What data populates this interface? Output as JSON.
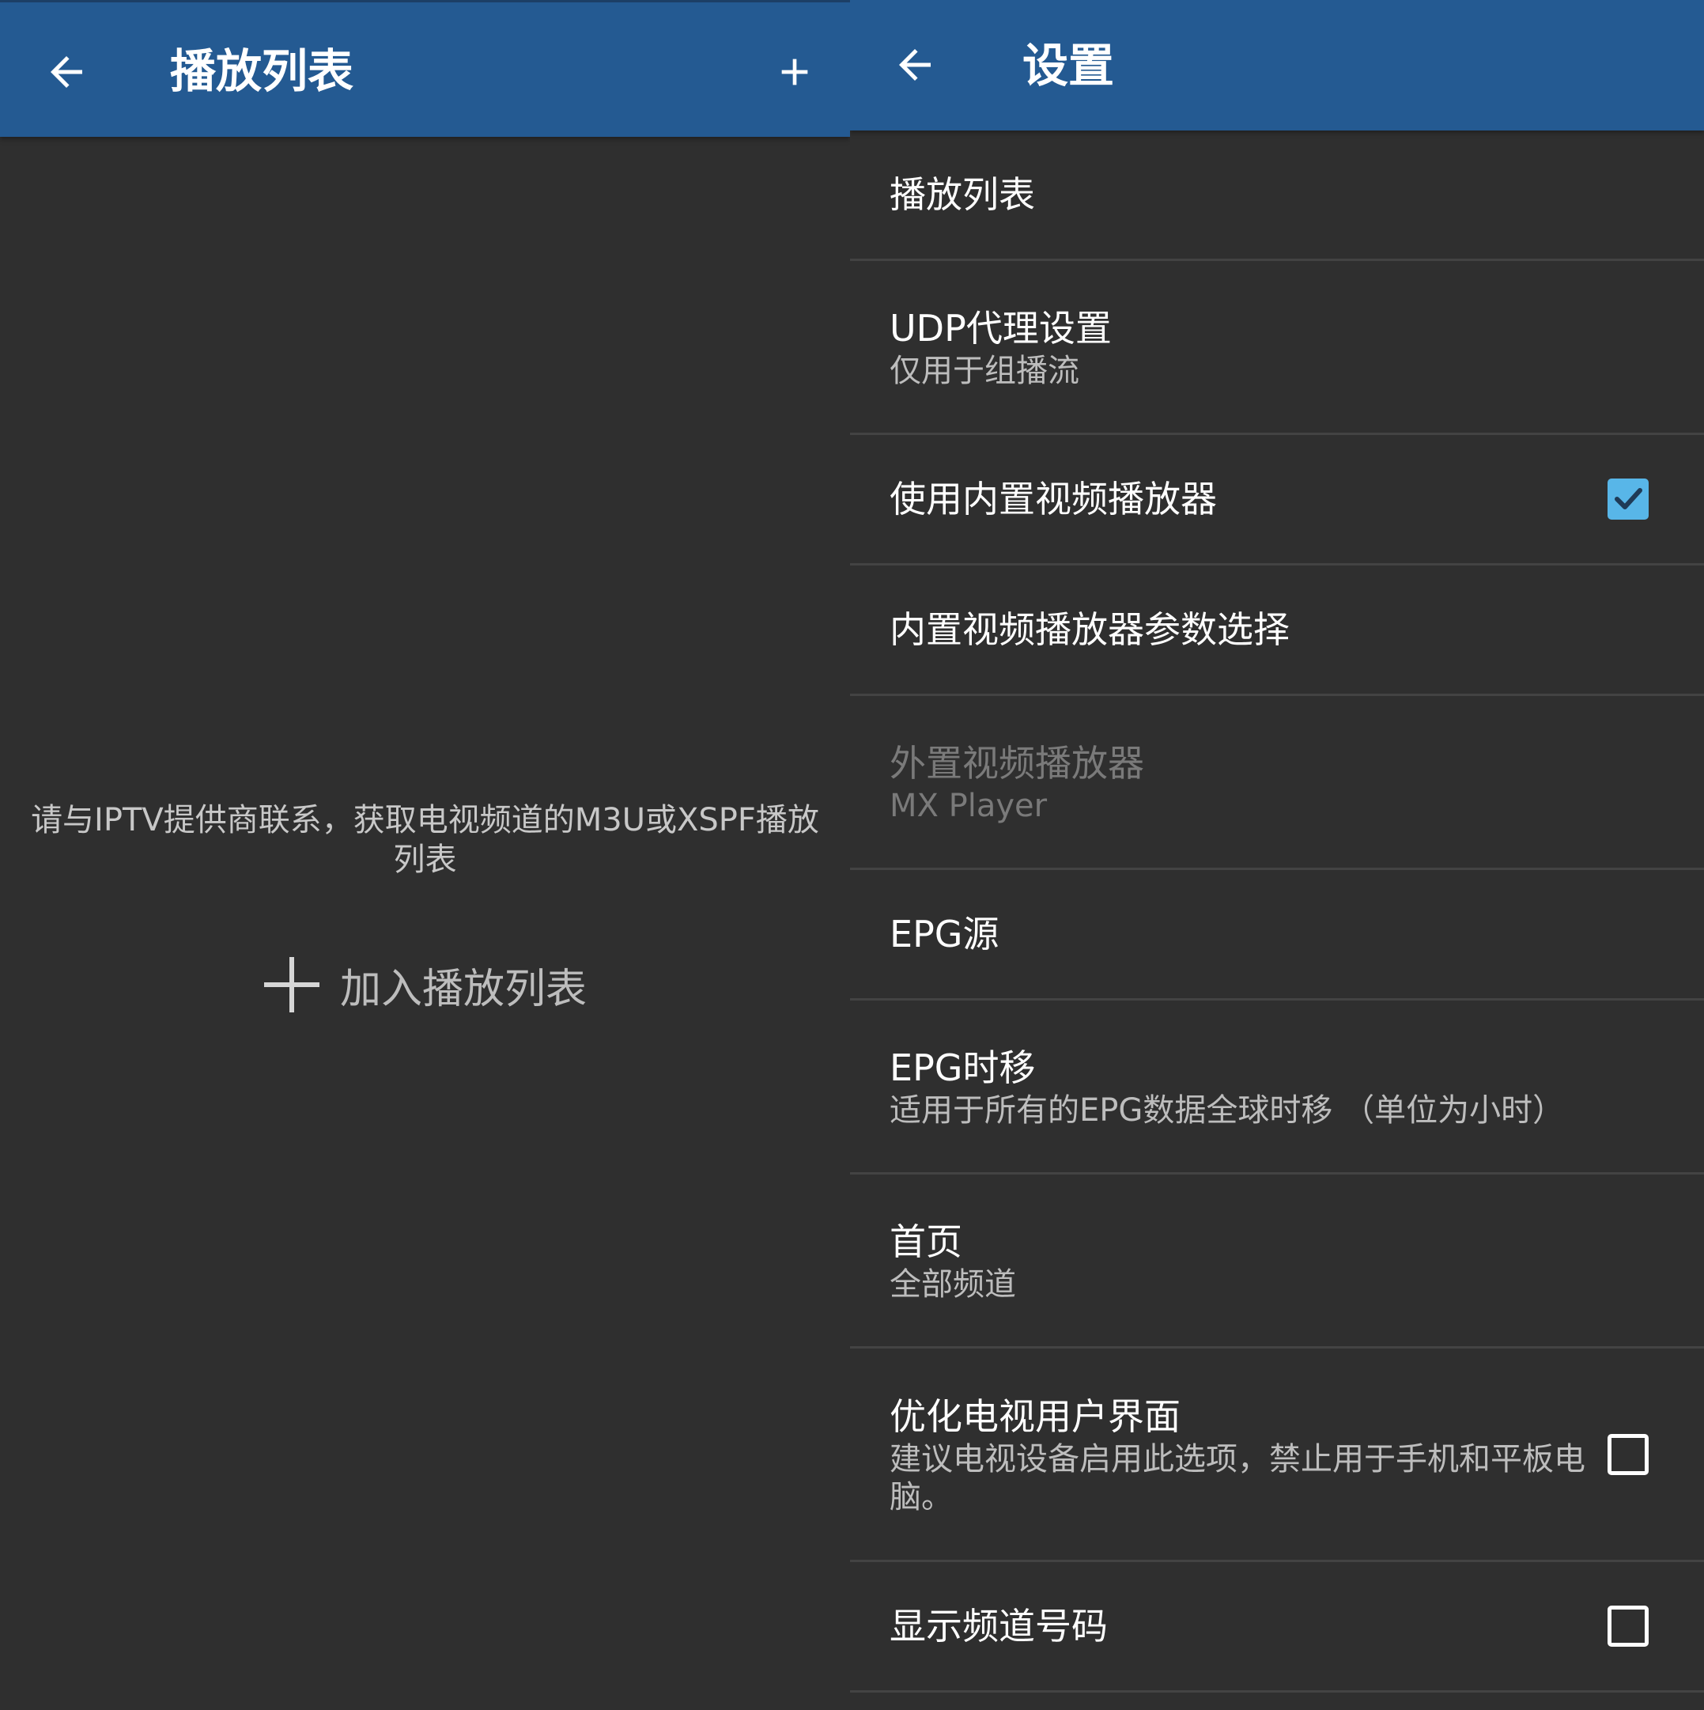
{
  "left_screen": {
    "title": "播放列表",
    "empty_message": "请与IPTV提供商联系，获取电视频道的M3U或XSPF播放列表",
    "add_playlist_label": "加入播放列表"
  },
  "right_screen": {
    "title": "设置",
    "settings": [
      {
        "title": "播放列表",
        "summary": ""
      },
      {
        "title": "UDP代理设置",
        "summary": "仅用于组播流"
      },
      {
        "title": "使用内置视频播放器",
        "summary": "",
        "checkbox": "checked"
      },
      {
        "title": "内置视频播放器参数选择",
        "summary": ""
      },
      {
        "title": "外置视频播放器",
        "summary": "MX Player",
        "state": "disabled"
      },
      {
        "title": "EPG源",
        "summary": ""
      },
      {
        "title": "EPG时移",
        "summary": "适用于所有的EPG数据全球时移 （单位为小时）"
      },
      {
        "title": "首页",
        "summary": "全部频道"
      },
      {
        "title": "优化电视用户界面",
        "summary": "建议电视设备启用此选项，禁止用于手机和平板电脑。",
        "checkbox": "unchecked"
      },
      {
        "title": "显示频道号码",
        "summary": "",
        "checkbox": "unchecked"
      }
    ]
  },
  "colors": {
    "app_bar": "#245a92",
    "background": "#2f2f2f",
    "divider": "#434343",
    "checkbox_checked": "#58b6e8",
    "primary_text": "#ffffff",
    "secondary_text": "#bdbdbd",
    "disabled_text": "#7a7a7a"
  },
  "icons": {
    "back": "arrow-left-icon",
    "add": "plus-icon",
    "check": "check-icon"
  }
}
